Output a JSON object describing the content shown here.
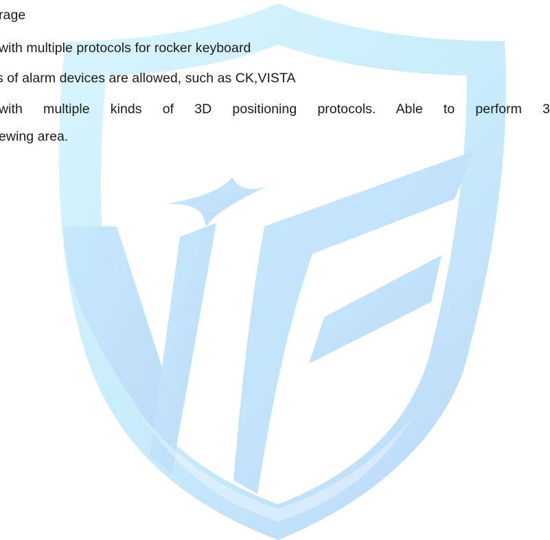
{
  "document": {
    "lines": [
      "rage",
      "with multiple protocols for rocker keyboard",
      "s of alarm devices are allowed, such as CK,VISTA",
      "with multiple kinds of 3D positioning protocols. Able to perform 3",
      "ewing area."
    ]
  },
  "watermark": {
    "logo": "shield-vf-logo-icon",
    "colors": {
      "light": "#d6f4fe",
      "mid": "#bde6fb",
      "deep": "#bcdaf8"
    }
  }
}
